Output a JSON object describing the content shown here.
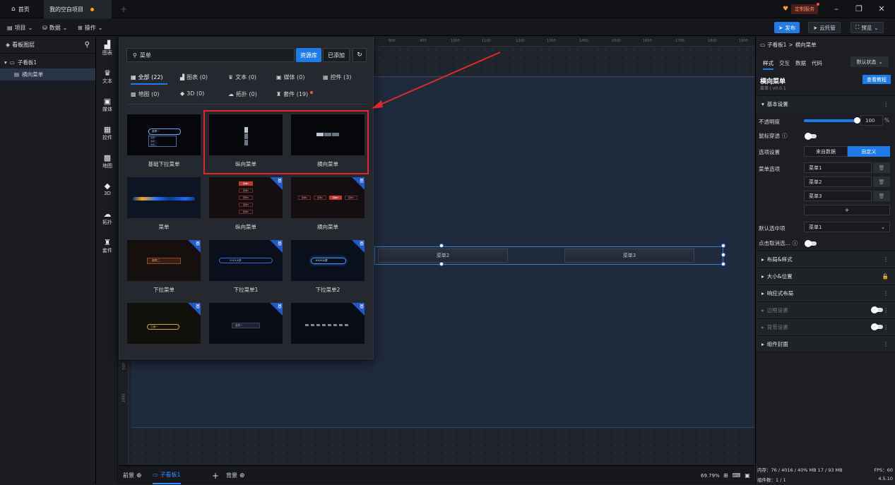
{
  "tabs": {
    "home": "首页",
    "project": "我的空白项目"
  },
  "topright": {
    "custom_service": "定制服务"
  },
  "menubar": {
    "items": [
      "项目",
      "数据",
      "操作"
    ],
    "publish": "发布",
    "cloud": "云托管",
    "preview": "预览"
  },
  "layers": {
    "title": "看板图层",
    "board": "子看板1",
    "item": "横向菜单"
  },
  "icon_col": [
    "图表",
    "文本",
    "媒体",
    "控件",
    "地图",
    "3D",
    "拓扑",
    "套件"
  ],
  "ruler": [
    "800",
    "900",
    "1000",
    "1100",
    "1200",
    "1300",
    "1400",
    "1500",
    "1600",
    "1700",
    "1800",
    "1900"
  ],
  "ruler_left": [
    "500",
    "1000"
  ],
  "library": {
    "search_value": "菜单",
    "btn_library": "资源库",
    "btn_added": "已添加",
    "categories": [
      "全部 (22)",
      "图表 (0)",
      "文本 (0)",
      "媒体 (0)",
      "控件 (3)",
      "地图 (0)",
      "3D (0)",
      "拓扑 (0)",
      "套件 (19)"
    ],
    "badge": "基",
    "cards": [
      {
        "label": "基础下拉菜单",
        "thumb": [
          "选项一",
          "选项一",
          "选项二",
          "选项三"
        ]
      },
      {
        "label": "纵向菜单"
      },
      {
        "label": "横向菜单"
      },
      {
        "label": "菜单"
      },
      {
        "label": "纵向菜单",
        "thumb": [
          "菜单1",
          "菜单2",
          "菜单3",
          "菜单4",
          "菜单5"
        ]
      },
      {
        "label": "横向菜单",
        "thumb": [
          "菜单1",
          "菜单2",
          "菜单3",
          "菜单4"
        ]
      },
      {
        "label": "下拉菜单",
        "thumb": [
          "选项二"
        ]
      },
      {
        "label": "下拉菜单1",
        "thumb": [
          "XXXX大屏"
        ]
      },
      {
        "label": "下拉菜单2",
        "thumb": [
          "XXXX大屏"
        ]
      },
      {
        "label": "",
        "thumb": [
          "三选一"
        ]
      },
      {
        "label": "",
        "thumb": [
          "选项一"
        ]
      },
      {
        "label": ""
      }
    ]
  },
  "canvas_menu": {
    "items": [
      "菜单2",
      "菜单3"
    ]
  },
  "bottom": {
    "front": "前景",
    "board": "子看板1",
    "back": "背景",
    "zoom": "69.79%"
  },
  "props": {
    "breadcrumb_root": "子看板1",
    "breadcrumb_sep": ">",
    "breadcrumb_leaf": "横向菜单",
    "tabs": [
      "样式",
      "交互",
      "数据",
      "代码"
    ],
    "state": "默认状态",
    "comp_title": "横向菜单",
    "comp_sub": "菜单 | v0.0.1",
    "tutorial": "查看教程",
    "sec_basic": "基本设置",
    "opacity_label": "不透明度",
    "opacity_value": "100",
    "opacity_unit": "%",
    "opacity_level": 1.0,
    "mouse_label": "鼠标穿透",
    "option_label": "选项设置",
    "opt_from_data": "来自数据",
    "opt_custom": "自定义",
    "menu_opts_label": "菜单选项",
    "menu_opts": [
      "菜单1",
      "菜单2",
      "菜单3"
    ],
    "add": "+",
    "default_label": "默认选中项",
    "default_value": "菜单1",
    "click_cancel": "点击取消选...",
    "sections": [
      "布局&样式",
      "大小&位置",
      "响应式布局",
      "边框设置",
      "背景设置",
      "组件封面"
    ]
  },
  "status": {
    "memory": "内存：76 / 4016 / 40% MB  17 / 93 MB",
    "fps": "FPS：60",
    "count": "组件数：1 / 1",
    "version": "4.5.10"
  }
}
